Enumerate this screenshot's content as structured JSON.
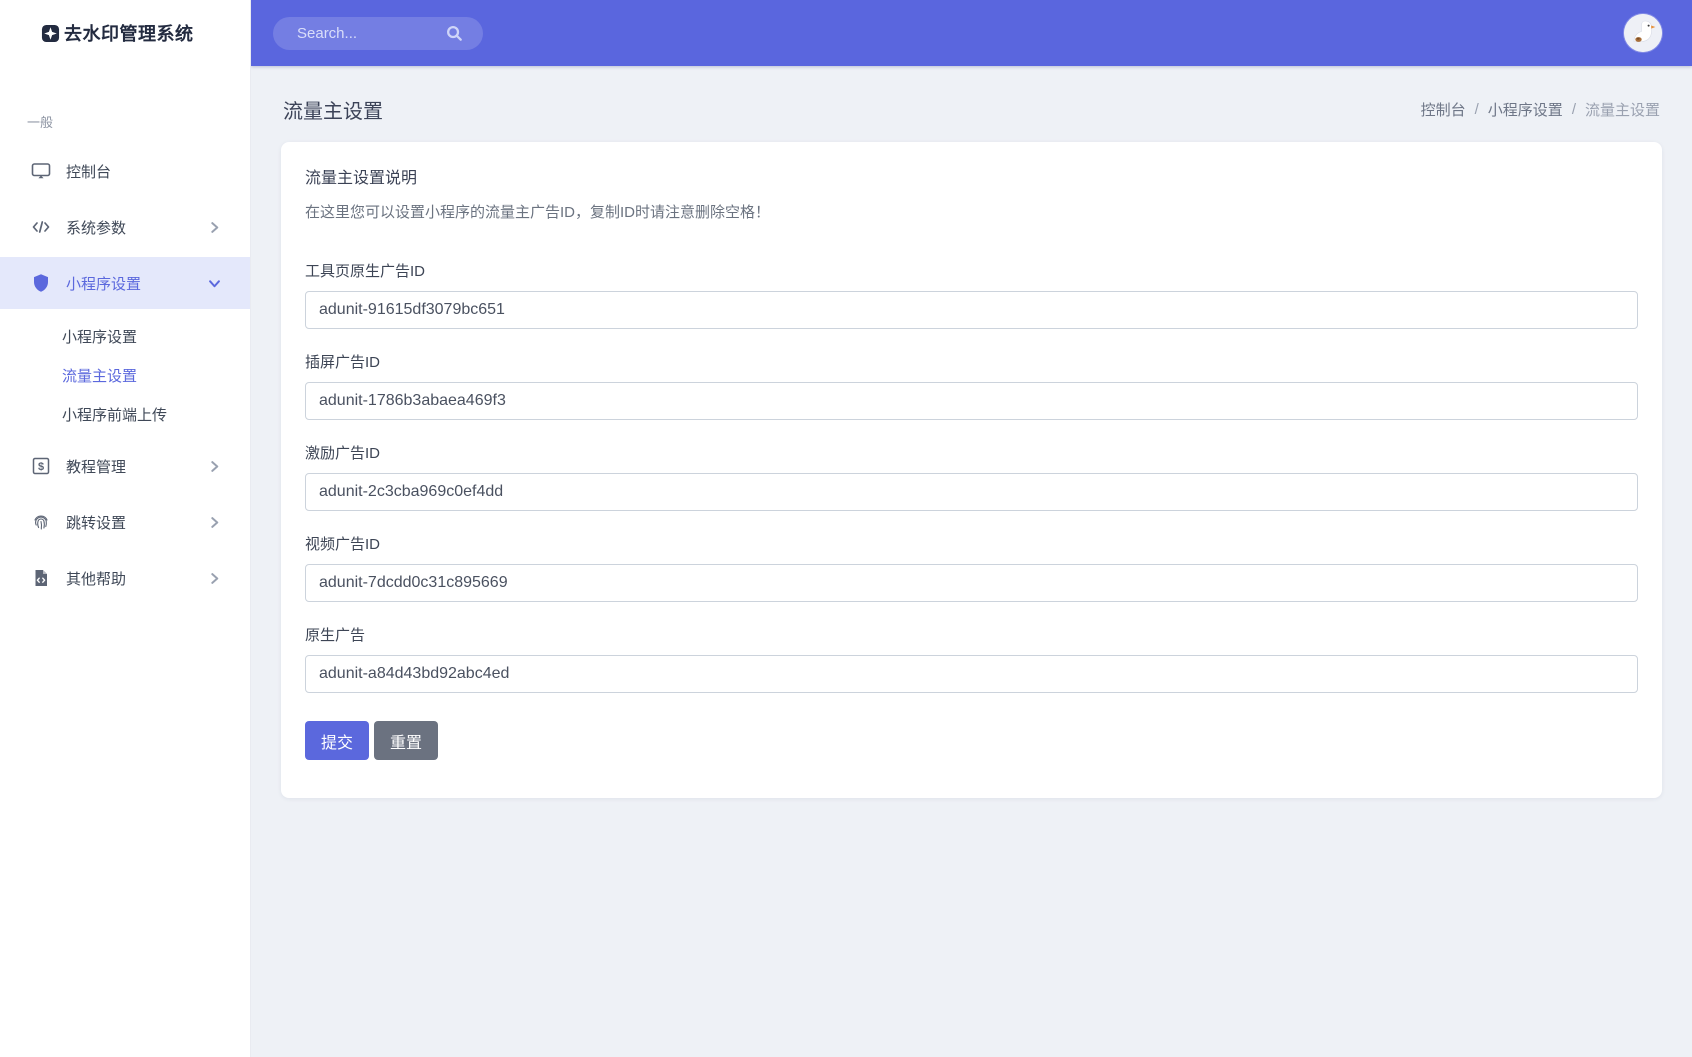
{
  "app": {
    "title": "去水印管理系统"
  },
  "topbar": {
    "search_placeholder": "Search..."
  },
  "sidebar": {
    "section_label": "一般",
    "items": [
      {
        "label": "控制台",
        "icon": "monitor-icon"
      },
      {
        "label": "系统参数",
        "icon": "code-icon"
      },
      {
        "label": "小程序设置",
        "icon": "shield-icon",
        "active": true,
        "expanded": true
      },
      {
        "label": "教程管理",
        "icon": "dollar-square-icon"
      },
      {
        "label": "跳转设置",
        "icon": "fingerprint-icon"
      },
      {
        "label": "其他帮助",
        "icon": "file-code-icon"
      }
    ],
    "submenu": [
      {
        "label": "小程序设置",
        "active": false
      },
      {
        "label": "流量主设置",
        "active": true
      },
      {
        "label": "小程序前端上传",
        "active": false
      }
    ]
  },
  "page": {
    "title": "流量主设置",
    "breadcrumb": [
      "控制台",
      "小程序设置",
      "流量主设置"
    ],
    "breadcrumb_separator": "/"
  },
  "form": {
    "heading": "流量主设置说明",
    "description": "在这里您可以设置小程序的流量主广告ID，复制ID时请注意删除空格！",
    "fields": [
      {
        "label": "工具页原生广告ID",
        "value": "adunit-91615df3079bc651"
      },
      {
        "label": "插屏广告ID",
        "value": "adunit-1786b3abaea469f3"
      },
      {
        "label": "激励广告ID",
        "value": "adunit-2c3cba969c0ef4dd"
      },
      {
        "label": "视频广告ID",
        "value": "adunit-7dcdd0c31c895669"
      },
      {
        "label": "原生广告",
        "value": "adunit-a84d43bd92abc4ed"
      }
    ],
    "submit_label": "提交",
    "reset_label": "重置"
  },
  "colors": {
    "header": "#5a66de",
    "accent": "#5b68dd",
    "gray_button": "#6b7280",
    "active_item_bg": "#e4e8fb",
    "page_bg": "#eef1f6"
  }
}
